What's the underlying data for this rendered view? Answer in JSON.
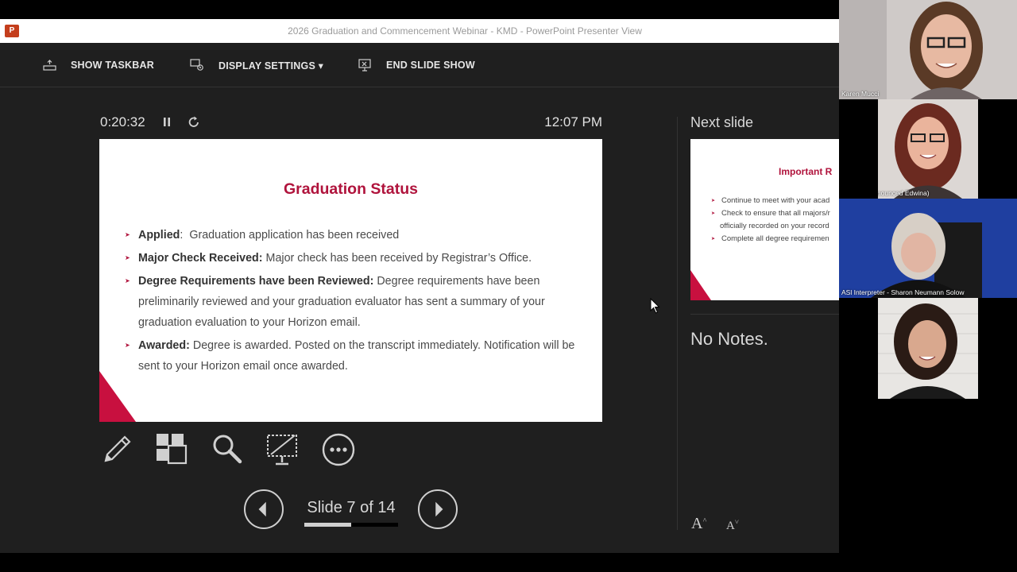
{
  "window": {
    "title": "2026 Graduation and Commencement Webinar - KMD - PowerPoint Presenter View",
    "app_icon": "powerpoint-icon"
  },
  "toolbar": {
    "show_taskbar": "SHOW TASKBAR",
    "display_settings": "DISPLAY SETTINGS ▾",
    "end_slide_show": "END SLIDE SHOW"
  },
  "presenter": {
    "timer": "0:20:32",
    "clock": "12:07 PM",
    "slide_counter": "Slide 7 of 14",
    "progress": 0.5
  },
  "current_slide": {
    "title": "Graduation Status",
    "bullets": [
      {
        "term": "Applied",
        "sep": ":  ",
        "text": "Graduation application has been received"
      },
      {
        "term": "Major Check Received:",
        "sep": " ",
        "text": "Major check has been received by Registrar’s Office."
      },
      {
        "term": "Degree Requirements have been Reviewed:",
        "sep": " ",
        "text": "Degree requirements have been preliminarily reviewed and your graduation evaluator has sent a summary of your graduation evaluation to your Horizon email."
      },
      {
        "term": "Awarded:",
        "sep": " ",
        "text": "Degree is awarded. Posted on the transcript immediately. Notification will be sent to your Horizon email once awarded."
      }
    ]
  },
  "next_slide": {
    "label": "Next slide",
    "title": "Important R",
    "bullets": [
      "Continue to meet with your acad",
      "Check to ensure that all majors/r",
      "officially recorded on your record",
      "Complete all degree requiremen"
    ]
  },
  "notes": {
    "text": "No Notes."
  },
  "participants": [
    {
      "name": "Karen Mucci"
    },
    {
      "name": "Eduina (Pronounced Edwina)"
    },
    {
      "name": "ASl Interpreter - Sharon Neumann Solow"
    },
    {
      "name": ""
    }
  ],
  "colors": {
    "accent": "#b0133c",
    "background": "#1f1f1f",
    "text": "#d8d8d8"
  }
}
